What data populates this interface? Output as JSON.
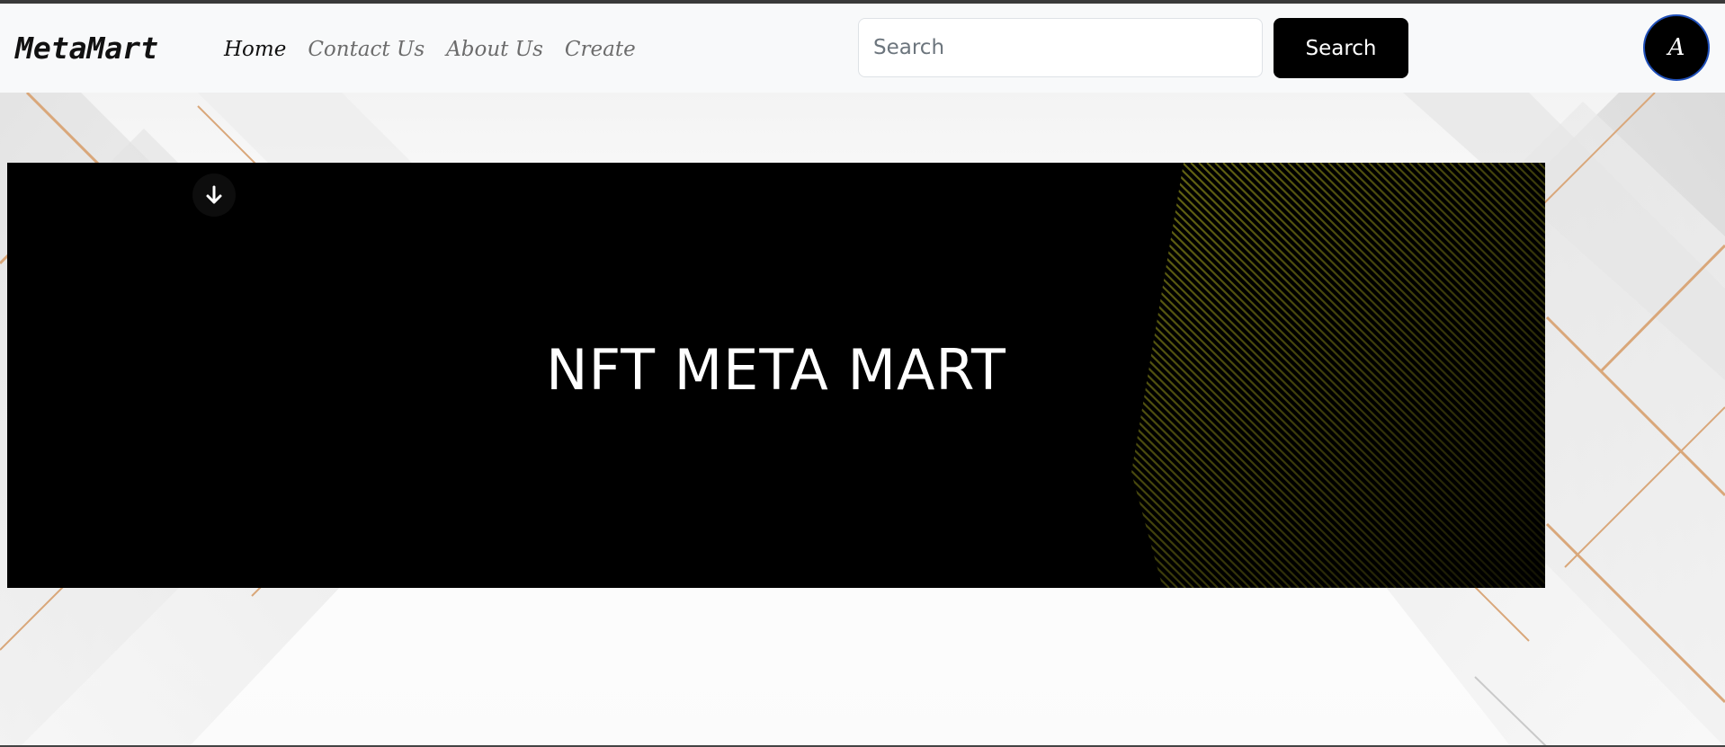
{
  "navbar": {
    "brand": "MetaMart",
    "links": [
      {
        "label": "Home",
        "active": true
      },
      {
        "label": "Contact Us",
        "active": false
      },
      {
        "label": "About Us",
        "active": false
      },
      {
        "label": "Create",
        "active": false
      }
    ],
    "search": {
      "placeholder": "Search",
      "value": "",
      "button_label": "Search"
    },
    "avatar_initial": "A"
  },
  "banner": {
    "title": "NFT META MART",
    "scroll_icon": "arrow-down-icon"
  },
  "colors": {
    "navbar_bg": "#f8f9fa",
    "button_bg": "#000000",
    "banner_bg": "#000000",
    "pattern_accent": "#8a8a1a",
    "background_accent": "#d9a77a"
  }
}
